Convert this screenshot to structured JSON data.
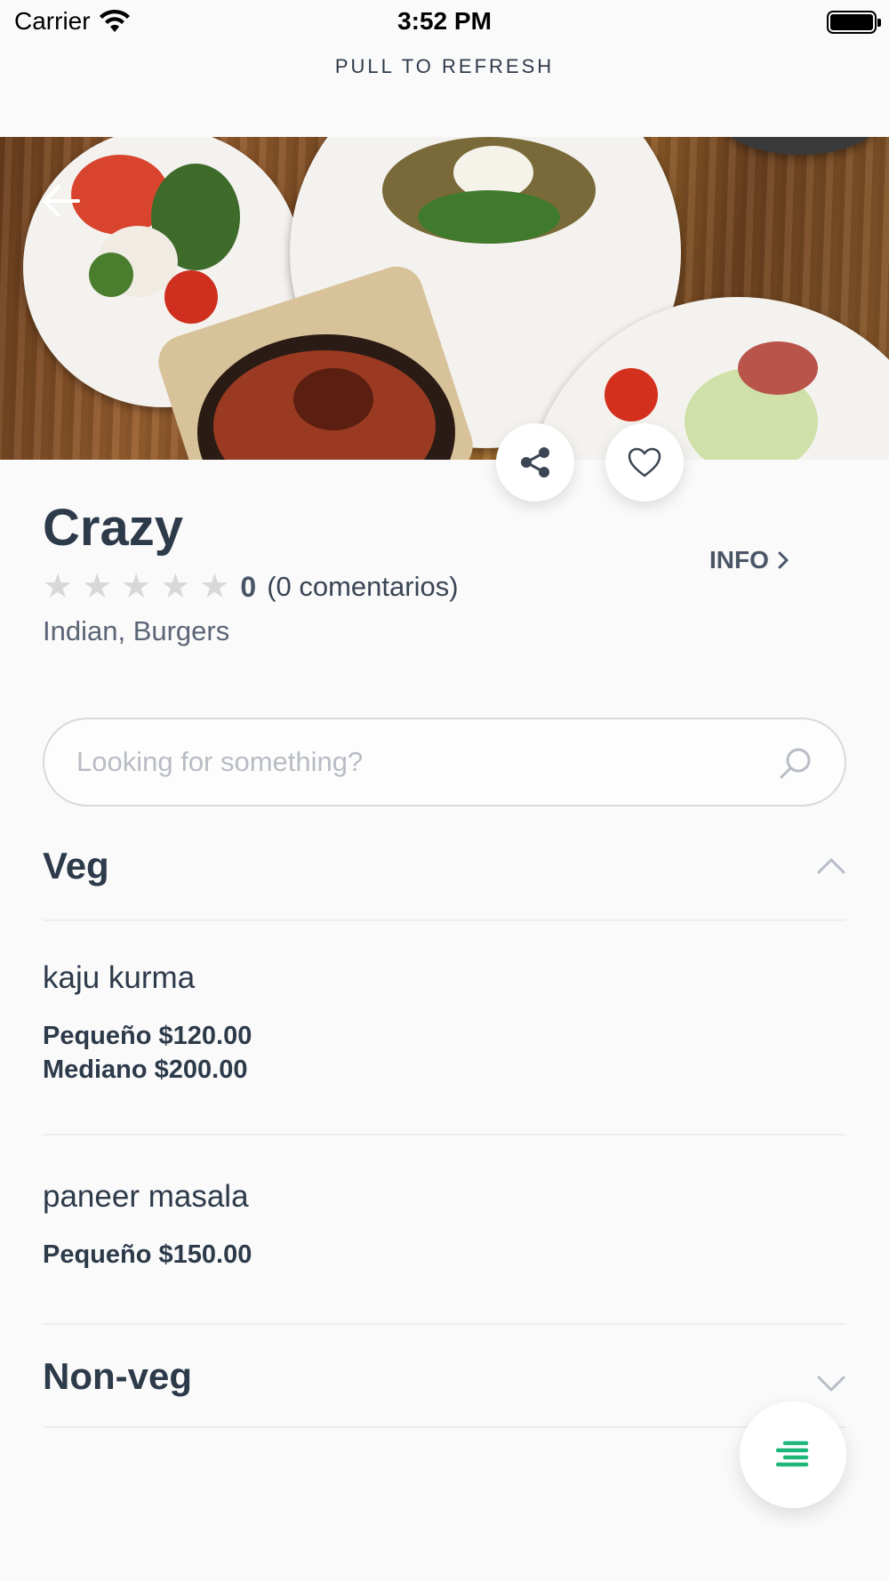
{
  "status_bar": {
    "carrier": "Carrier",
    "time": "3:52 PM"
  },
  "pull_to_refresh": "PULL TO REFRESH",
  "restaurant": {
    "name": "Crazy",
    "rating_value": "0",
    "rating_stars": 0,
    "rating_count": "(0 comentarios)",
    "cuisines": "Indian, Burgers",
    "info_label": "INFO"
  },
  "search": {
    "placeholder": "Looking for something?",
    "value": ""
  },
  "categories": [
    {
      "title": "Veg",
      "expanded": true,
      "items": [
        {
          "name": "kaju kurma",
          "prices": [
            "Pequeño $120.00",
            "Mediano $200.00"
          ]
        },
        {
          "name": "paneer masala",
          "prices": [
            "Pequeño $150.00"
          ]
        }
      ]
    },
    {
      "title": "Non-veg",
      "expanded": false,
      "items": []
    }
  ],
  "icons": {
    "back": "back-arrow-icon",
    "share": "share-icon",
    "favorite": "heart-icon",
    "search": "search-icon",
    "menu": "menu-list-icon"
  },
  "colors": {
    "accent": "#1fb67a",
    "text": "#2d3a4a"
  }
}
